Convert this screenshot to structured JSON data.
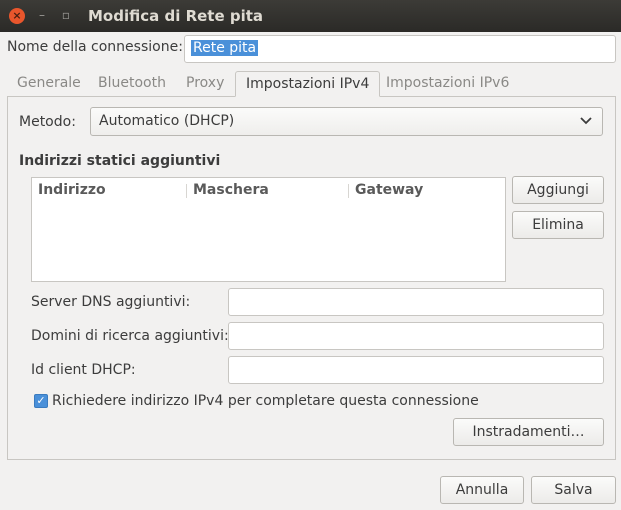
{
  "window": {
    "title": "Modifica di Rete pita",
    "close_glyph": "×",
    "min_glyph": "–",
    "max_glyph": "▫"
  },
  "connection": {
    "label": "Nome della connessione:",
    "value": "Rete pita"
  },
  "tabs": [
    {
      "label": "Generale"
    },
    {
      "label": "Bluetooth"
    },
    {
      "label": "Proxy"
    },
    {
      "label": "Impostazioni IPv4",
      "active": true
    },
    {
      "label": "Impostazioni IPv6"
    }
  ],
  "method": {
    "label": "Metodo:",
    "value": "Automatico (DHCP)"
  },
  "static_addresses": {
    "title": "Indirizzi statici aggiuntivi",
    "columns": [
      "Indirizzo",
      "Maschera",
      "Gateway"
    ],
    "add_label": "Aggiungi",
    "delete_label": "Elimina"
  },
  "fields": {
    "dns_label": "Server DNS aggiuntivi:",
    "dns_value": "",
    "search_label": "Domini di ricerca aggiuntivi:",
    "search_value": "",
    "dhcp_label": "Id client DHCP:",
    "dhcp_value": ""
  },
  "require_ipv4": {
    "label": "Richiedere indirizzo IPv4 per completare questa connessione",
    "checked": true,
    "glyph": "✓"
  },
  "routes_label": "Instradamenti…",
  "footer": {
    "cancel_label": "Annulla",
    "save_label": "Salva"
  },
  "colors": {
    "titlebar": "#2e2d2b",
    "accent": "#4a90d9",
    "close_button": "#e9562c"
  }
}
